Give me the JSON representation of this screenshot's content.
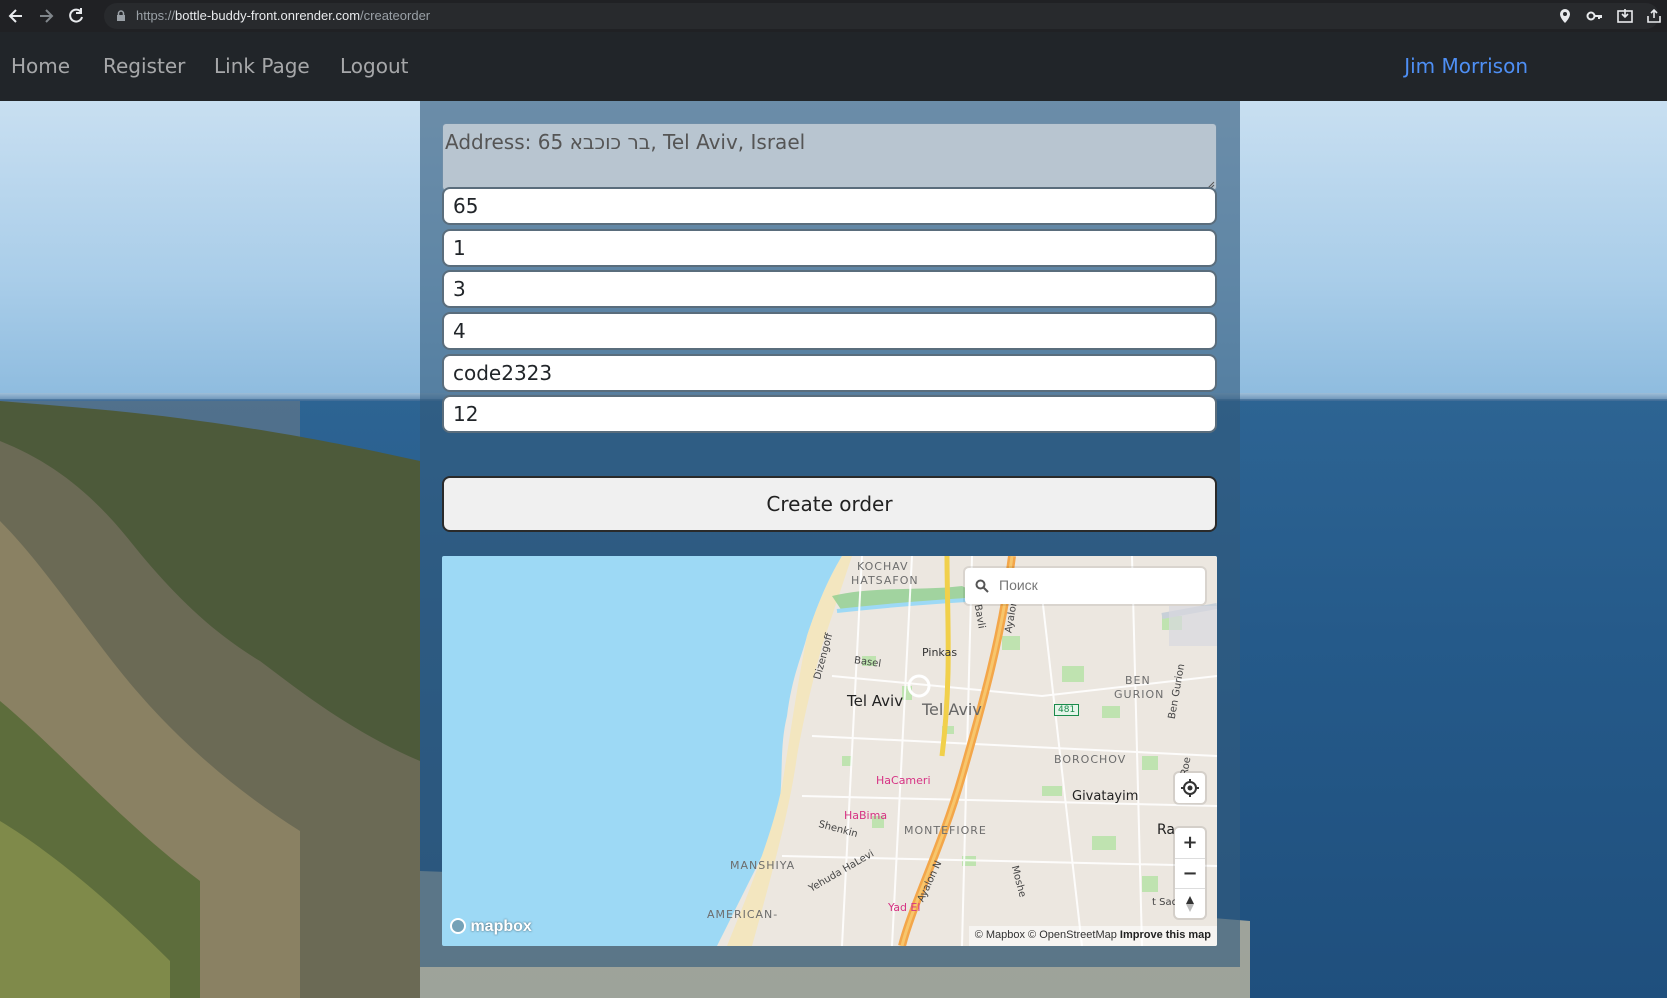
{
  "browser": {
    "url_scheme": "https://",
    "url_host": "bottle-buddy-front.onrender.com",
    "url_path": "/createorder"
  },
  "nav": {
    "links": [
      "Home",
      "Register",
      "Link Page",
      "Logout"
    ],
    "user": "Jim Morrison"
  },
  "form": {
    "address_placeholder": "Address: 65 בר כוכבא, Tel Aviv, Israel",
    "fields": [
      "65",
      "1",
      "3",
      "4",
      "code2323",
      "12"
    ],
    "submit_label": "Create order"
  },
  "map": {
    "search_placeholder": "Поиск",
    "labels": {
      "kochav": "KOCHAV",
      "hatsafon": "HATSAFON",
      "bavli": "Bavli",
      "ayalon_top": "Ayalon",
      "dizengoff": "Dizengoff",
      "basel": "Basel",
      "pinkas": "Pinkas",
      "ben": "BEN",
      "gurion_area": "GURION",
      "ben_gurion": "Ben Gurion",
      "tel_aviv_1": "Tel Aviv",
      "tel_aviv_2": "Tel Aviv",
      "route": "481",
      "borochov": "BOROCHOV",
      "hacameri": "HaCameri",
      "habima": "HaBima",
      "givatayim": "Givatayim",
      "shenkin": "Shenkin",
      "montefiore": "MONTEFIORE",
      "ra": "Ra",
      "manshiya": "MANSHIYA",
      "yehuda_halevi": "Yehuda HaLevi",
      "ayalon_n": "Ayalon N",
      "moshe": "Moshe",
      "american": "AMERICAN-",
      "yad_eliyahu": "Yad El",
      "sadeh": "t Sadeh",
      "roe": "Roe"
    },
    "logo": "mapbox",
    "attribution": "© Mapbox © OpenStreetMap",
    "improve": "Improve this map"
  },
  "colors": {
    "user_link": "#4e8ff4",
    "map_water": "#9dd9f5",
    "navbar_bg": "#212529"
  }
}
